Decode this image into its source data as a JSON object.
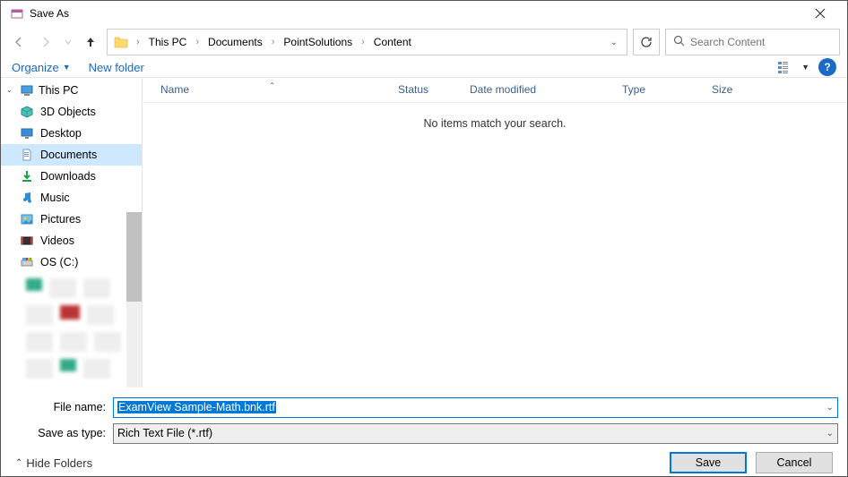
{
  "title": "Save As",
  "nav": {
    "breadcrumb": [
      "This PC",
      "Documents",
      "PointSolutions",
      "Content"
    ]
  },
  "search": {
    "placeholder": "Search Content"
  },
  "toolbar": {
    "organize": "Organize",
    "newfolder": "New folder"
  },
  "tree": {
    "root": "This PC",
    "items": [
      {
        "label": "3D Objects",
        "icon": "cube"
      },
      {
        "label": "Desktop",
        "icon": "desktop"
      },
      {
        "label": "Documents",
        "icon": "doc",
        "selected": true
      },
      {
        "label": "Downloads",
        "icon": "down"
      },
      {
        "label": "Music",
        "icon": "music"
      },
      {
        "label": "Pictures",
        "icon": "pic"
      },
      {
        "label": "Videos",
        "icon": "video"
      },
      {
        "label": "OS (C:)",
        "icon": "drive"
      }
    ]
  },
  "list": {
    "cols": {
      "name": "Name",
      "status": "Status",
      "date": "Date modified",
      "type": "Type",
      "size": "Size"
    },
    "empty": "No items match your search."
  },
  "fields": {
    "filename_label": "File name:",
    "filename_value": "ExamView Sample-Math.bnk.rtf",
    "type_label": "Save as type:",
    "type_value": "Rich Text File (*.rtf)"
  },
  "footer": {
    "hide": "Hide Folders",
    "save": "Save",
    "cancel": "Cancel"
  }
}
